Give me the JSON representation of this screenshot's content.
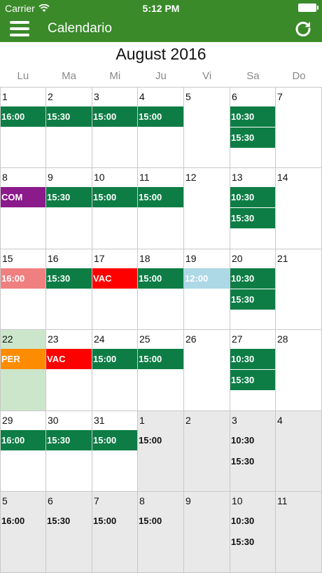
{
  "status": {
    "carrier": "Carrier",
    "time": "5:12 PM"
  },
  "nav": {
    "title": "Calendario"
  },
  "calendar": {
    "month_title": "August 2016",
    "weekdays": [
      "Lu",
      "Ma",
      "Mi",
      "Ju",
      "Vi",
      "Sa",
      "Do"
    ],
    "colors": {
      "green": "#0d7d45",
      "purple": "#8b1a8b",
      "pink": "#f08080",
      "red": "#ff0000",
      "lightblue": "#add8e6",
      "orange": "#ff8c00",
      "today": "#cce6cc",
      "other_month": "#e9e9e9",
      "header": "#3a8a2a"
    },
    "weeks": [
      [
        {
          "day": "1",
          "events": [
            {
              "label": "16:00",
              "color": "green"
            }
          ]
        },
        {
          "day": "2",
          "events": [
            {
              "label": "15:30",
              "color": "green"
            }
          ]
        },
        {
          "day": "3",
          "events": [
            {
              "label": "15:00",
              "color": "green"
            }
          ]
        },
        {
          "day": "4",
          "events": [
            {
              "label": "15:00",
              "color": "green"
            }
          ]
        },
        {
          "day": "5",
          "events": []
        },
        {
          "day": "6",
          "events": [
            {
              "label": "10:30",
              "color": "green"
            },
            {
              "label": "15:30",
              "color": "green"
            }
          ]
        },
        {
          "day": "7",
          "events": []
        }
      ],
      [
        {
          "day": "8",
          "events": [
            {
              "label": "COM",
              "color": "purple"
            }
          ]
        },
        {
          "day": "9",
          "events": [
            {
              "label": "15:30",
              "color": "green"
            }
          ]
        },
        {
          "day": "10",
          "events": [
            {
              "label": "15:00",
              "color": "green"
            }
          ]
        },
        {
          "day": "11",
          "events": [
            {
              "label": "15:00",
              "color": "green"
            }
          ]
        },
        {
          "day": "12",
          "events": []
        },
        {
          "day": "13",
          "events": [
            {
              "label": "10:30",
              "color": "green"
            },
            {
              "label": "15:30",
              "color": "green"
            }
          ]
        },
        {
          "day": "14",
          "events": []
        }
      ],
      [
        {
          "day": "15",
          "events": [
            {
              "label": "16:00",
              "color": "pink"
            }
          ]
        },
        {
          "day": "16",
          "events": [
            {
              "label": "15:30",
              "color": "green"
            }
          ]
        },
        {
          "day": "17",
          "events": [
            {
              "label": "VAC",
              "color": "red"
            }
          ]
        },
        {
          "day": "18",
          "events": [
            {
              "label": "15:00",
              "color": "green"
            }
          ]
        },
        {
          "day": "19",
          "events": [
            {
              "label": "12:00",
              "color": "lightblue"
            }
          ]
        },
        {
          "day": "20",
          "events": [
            {
              "label": "10:30",
              "color": "green"
            },
            {
              "label": "15:30",
              "color": "green"
            }
          ]
        },
        {
          "day": "21",
          "events": []
        }
      ],
      [
        {
          "day": "22",
          "today": true,
          "events": [
            {
              "label": "PER",
              "color": "orange"
            }
          ]
        },
        {
          "day": "23",
          "events": [
            {
              "label": "VAC",
              "color": "red"
            }
          ]
        },
        {
          "day": "24",
          "events": [
            {
              "label": "15:00",
              "color": "green"
            }
          ]
        },
        {
          "day": "25",
          "events": [
            {
              "label": "15:00",
              "color": "green"
            }
          ]
        },
        {
          "day": "26",
          "events": []
        },
        {
          "day": "27",
          "events": [
            {
              "label": "10:30",
              "color": "green"
            },
            {
              "label": "15:30",
              "color": "green"
            }
          ]
        },
        {
          "day": "28",
          "events": []
        }
      ],
      [
        {
          "day": "29",
          "events": [
            {
              "label": "16:00",
              "color": "green"
            }
          ]
        },
        {
          "day": "30",
          "events": [
            {
              "label": "15:30",
              "color": "green"
            }
          ]
        },
        {
          "day": "31",
          "events": [
            {
              "label": "15:00",
              "color": "green"
            }
          ]
        },
        {
          "day": "1",
          "other": true,
          "events": [
            {
              "label": "15:00",
              "color": "none"
            }
          ]
        },
        {
          "day": "2",
          "other": true,
          "events": []
        },
        {
          "day": "3",
          "other": true,
          "events": [
            {
              "label": "10:30",
              "color": "none"
            },
            {
              "label": "15:30",
              "color": "none"
            }
          ]
        },
        {
          "day": "4",
          "other": true,
          "events": []
        }
      ],
      [
        {
          "day": "5",
          "other": true,
          "events": [
            {
              "label": "16:00",
              "color": "none"
            }
          ]
        },
        {
          "day": "6",
          "other": true,
          "events": [
            {
              "label": "15:30",
              "color": "none"
            }
          ]
        },
        {
          "day": "7",
          "other": true,
          "events": [
            {
              "label": "15:00",
              "color": "none"
            }
          ]
        },
        {
          "day": "8",
          "other": true,
          "events": [
            {
              "label": "15:00",
              "color": "none"
            }
          ]
        },
        {
          "day": "9",
          "other": true,
          "events": []
        },
        {
          "day": "10",
          "other": true,
          "events": [
            {
              "label": "10:30",
              "color": "none"
            },
            {
              "label": "15:30",
              "color": "none"
            }
          ]
        },
        {
          "day": "11",
          "other": true,
          "events": []
        }
      ]
    ]
  }
}
